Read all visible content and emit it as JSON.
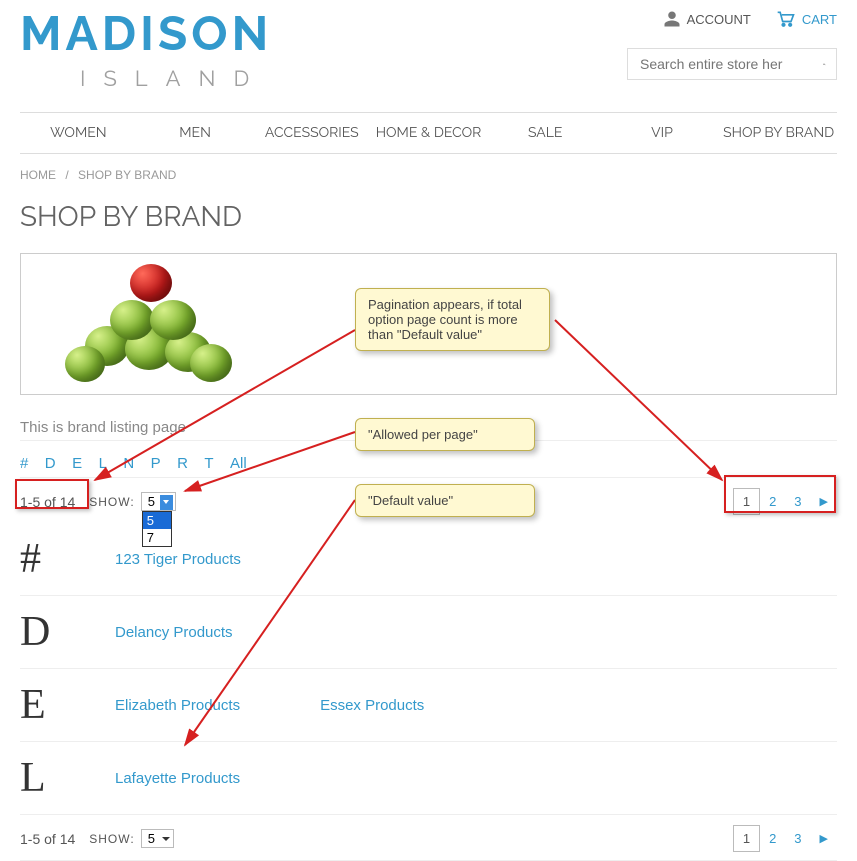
{
  "header": {
    "logo_main": "MADISON",
    "logo_sub": "ISLAND",
    "account_label": "ACCOUNT",
    "cart_label": "CART",
    "search_placeholder": "Search entire store her"
  },
  "nav": {
    "items": [
      "WOMEN",
      "MEN",
      "ACCESSORIES",
      "HOME & DECOR",
      "SALE",
      "VIP",
      "SHOP BY BRAND"
    ]
  },
  "breadcrumb": {
    "home": "HOME",
    "current": "SHOP BY BRAND"
  },
  "page_title": "SHOP BY BRAND",
  "listing_desc": "This is brand listing page",
  "alpha_filter": [
    "#",
    "D",
    "E",
    "L",
    "N",
    "P",
    "R",
    "T",
    "All"
  ],
  "toolbar": {
    "count": "1-5 of 14",
    "show_label": "SHOW:",
    "show_value": "5",
    "show_options": [
      "5",
      "7"
    ]
  },
  "pagination": {
    "pages": [
      "1",
      "2",
      "3"
    ],
    "current": "1",
    "next_symbol": "▶"
  },
  "sections": [
    {
      "letter": "#",
      "brands": [
        "123 Tiger Products"
      ]
    },
    {
      "letter": "D",
      "brands": [
        "Delancy Products"
      ]
    },
    {
      "letter": "E",
      "brands": [
        "Elizabeth Products",
        "Essex Products"
      ]
    },
    {
      "letter": "L",
      "brands": [
        "Lafayette Products"
      ]
    }
  ],
  "callouts": {
    "pagination": "Pagination appears, if total option page count is more than \"Default value\"",
    "allowed": "\"Allowed per page\"",
    "default": "\"Default value\""
  }
}
